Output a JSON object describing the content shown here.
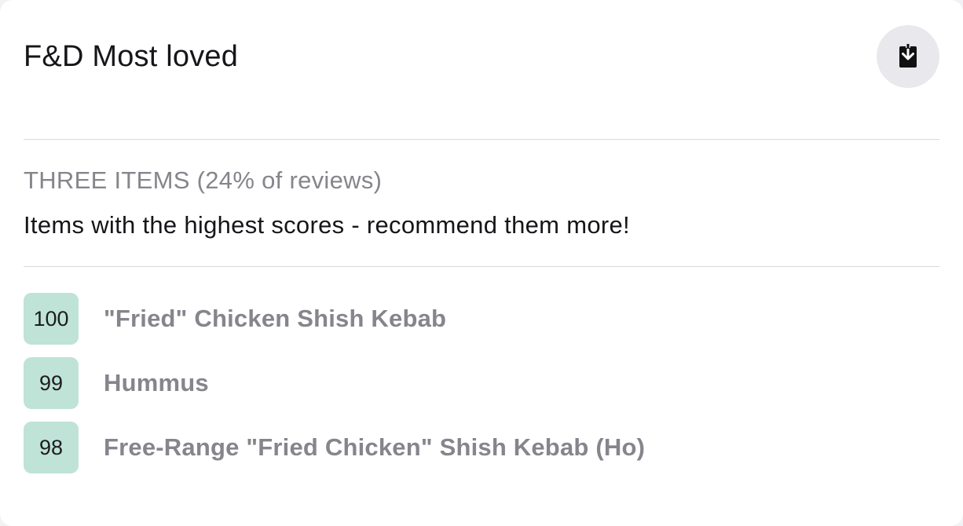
{
  "card": {
    "title": "F&D Most loved",
    "download_icon": "download-icon"
  },
  "summary": {
    "label": "THREE ITEMS (24% of reviews)",
    "description": "Items with the highest scores - recommend them more!"
  },
  "items": [
    {
      "score": "100",
      "name": "\"Fried\" Chicken Shish Kebab"
    },
    {
      "score": "99",
      "name": "Hummus"
    },
    {
      "score": "98",
      "name": "Free-Range \"Fried Chicken\" Shish Kebab (Ho)"
    }
  ],
  "colors": {
    "score_badge_bg": "#bfe3d7",
    "muted_text": "#85858c",
    "primary_text": "#16161a",
    "button_bg": "#e8e8ed"
  }
}
